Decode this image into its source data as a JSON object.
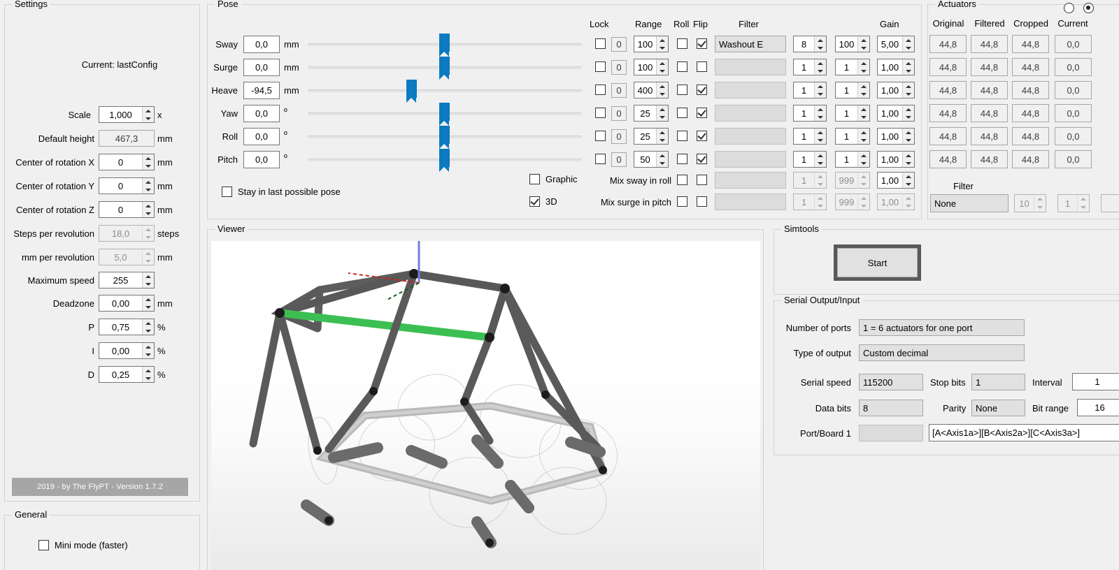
{
  "settings": {
    "group_title": "Settings",
    "current_label": "Current: lastConfig",
    "rows": [
      {
        "label": "Scale",
        "value": "1,000",
        "unit": "x",
        "disabled": false
      },
      {
        "label": "Default height",
        "value": "467,3",
        "unit": "mm",
        "disabled": false
      },
      {
        "label": "Center of rotation X",
        "value": "0",
        "unit": "mm",
        "disabled": false
      },
      {
        "label": "Center of rotation Y",
        "value": "0",
        "unit": "mm",
        "disabled": false
      },
      {
        "label": "Center of rotation Z",
        "value": "0",
        "unit": "mm",
        "disabled": false
      },
      {
        "label": "Steps per revolution",
        "value": "18,0",
        "unit": "steps",
        "disabled": true
      },
      {
        "label": "mm per revolution",
        "value": "5,0",
        "unit": "mm",
        "disabled": true
      },
      {
        "label": "Maximum speed",
        "value": "255",
        "unit": "",
        "disabled": false
      },
      {
        "label": "Deadzone",
        "value": "0,00",
        "unit": "mm",
        "disabled": false
      },
      {
        "label": "P",
        "value": "0,75",
        "unit": "%",
        "disabled": false
      },
      {
        "label": "I",
        "value": "0,00",
        "unit": "%",
        "disabled": false
      },
      {
        "label": "D",
        "value": "0,25",
        "unit": "%",
        "disabled": false
      }
    ],
    "footer": "2019 - by The FlyPT - Version 1.7.2"
  },
  "general": {
    "group_title": "General",
    "mini_mode_label": "Mini mode (faster)",
    "mini_mode_checked": false
  },
  "pose": {
    "group_title": "Pose",
    "headers": {
      "lock": "Lock",
      "range": "Range",
      "roll": "Roll",
      "flip": "Flip",
      "filter": "Filter",
      "gain": "Gain"
    },
    "axes": [
      {
        "name": "Sway",
        "value": "0,0",
        "unit": "mm",
        "slider_pct": 50,
        "lock": false,
        "lock_val": "0",
        "range": "100",
        "roll": false,
        "flip": true,
        "filter": "Washout E",
        "filter_disabled": false,
        "p1": "8",
        "p2": "100",
        "gain": "5,00"
      },
      {
        "name": "Surge",
        "value": "0,0",
        "unit": "mm",
        "slider_pct": 50,
        "lock": false,
        "lock_val": "0",
        "range": "100",
        "roll": false,
        "flip": false,
        "filter": "",
        "filter_disabled": true,
        "p1": "1",
        "p2": "1",
        "gain": "1,00"
      },
      {
        "name": "Heave",
        "value": "-94,5",
        "unit": "mm",
        "slider_pct": 37.5,
        "lock": false,
        "lock_val": "0",
        "range": "400",
        "roll": false,
        "flip": true,
        "filter": "",
        "filter_disabled": true,
        "p1": "1",
        "p2": "1",
        "gain": "1,00"
      },
      {
        "name": "Yaw",
        "value": "0,0",
        "unit": "º",
        "slider_pct": 50,
        "lock": false,
        "lock_val": "0",
        "range": "25",
        "roll": false,
        "flip": true,
        "filter": "",
        "filter_disabled": true,
        "p1": "1",
        "p2": "1",
        "gain": "1,00"
      },
      {
        "name": "Roll",
        "value": "0,0",
        "unit": "º",
        "slider_pct": 50,
        "lock": false,
        "lock_val": "0",
        "range": "25",
        "roll": false,
        "flip": true,
        "filter": "",
        "filter_disabled": true,
        "p1": "1",
        "p2": "1",
        "gain": "1,00"
      },
      {
        "name": "Pitch",
        "value": "0,0",
        "unit": "º",
        "slider_pct": 50,
        "lock": false,
        "lock_val": "0",
        "range": "50",
        "roll": false,
        "flip": true,
        "filter": "",
        "filter_disabled": true,
        "p1": "1",
        "p2": "1",
        "gain": "1,00"
      }
    ],
    "mix_rows": [
      {
        "label": "Mix sway in roll",
        "roll": false,
        "flip": false,
        "filter": "",
        "p1": "1",
        "p2": "999",
        "gain": "1,00",
        "gain_disabled": false
      },
      {
        "label": "Mix surge in pitch",
        "roll": false,
        "flip": false,
        "filter": "",
        "p1": "1",
        "p2": "999",
        "gain": "1,00",
        "gain_disabled": true
      }
    ],
    "stay_label": "Stay in last possible pose",
    "stay_checked": false,
    "graphic_label": "Graphic",
    "graphic_checked": false,
    "three_d_label": "3D",
    "three_d_checked": true
  },
  "viewer": {
    "group_title": "Viewer"
  },
  "actuators": {
    "group_title": "Actuators",
    "radio_left_selected": false,
    "radio_right_selected": true,
    "columns": [
      "Original",
      "Filtered",
      "Cropped",
      "Current"
    ],
    "rows": [
      [
        "44,8",
        "44,8",
        "44,8",
        "0,0"
      ],
      [
        "44,8",
        "44,8",
        "44,8",
        "0,0"
      ],
      [
        "44,8",
        "44,8",
        "44,8",
        "0,0"
      ],
      [
        "44,8",
        "44,8",
        "44,8",
        "0,0"
      ],
      [
        "44,8",
        "44,8",
        "44,8",
        "0,0"
      ],
      [
        "44,8",
        "44,8",
        "44,8",
        "0,0"
      ]
    ],
    "filter_label": "Filter",
    "filter_value": "None",
    "filter_p1": "10",
    "filter_p2": "1"
  },
  "simtools": {
    "group_title": "Simtools",
    "start_label": "Start"
  },
  "serial": {
    "group_title": "Serial Output/Input",
    "number_of_ports_label": "Number of ports",
    "number_of_ports_value": "1 = 6 actuators for one port",
    "type_of_output_label": "Type of output",
    "type_of_output_value": "Custom decimal",
    "serial_speed_label": "Serial speed",
    "serial_speed_value": "115200",
    "stop_bits_label": "Stop bits",
    "stop_bits_value": "1",
    "interval_label": "Interval",
    "interval_value": "1",
    "data_bits_label": "Data bits",
    "data_bits_value": "8",
    "parity_label": "Parity",
    "parity_value": "None",
    "bit_range_label": "Bit range",
    "bit_range_value": "16",
    "port_board_label": "Port/Board 1",
    "port_board_value": "",
    "format_string": "[A<Axis1a>][B<Axis2a>][C<Axis3a>]"
  },
  "colors": {
    "accent_blue": "#0c7ac0",
    "window_bg": "#f0f0f0",
    "rig_green": "#3cbf52",
    "rig_dark": "#5a5a5a",
    "axis_blue": "#7b7bdb",
    "axis_red": "#d02020"
  }
}
